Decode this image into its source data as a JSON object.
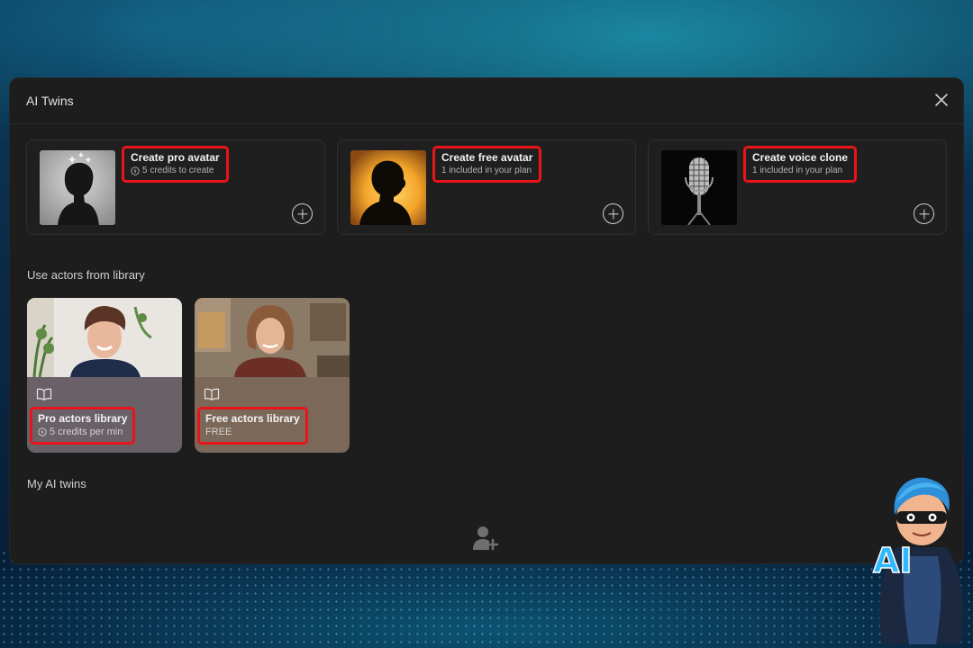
{
  "modal": {
    "title": "AI Twins",
    "close_icon": "close-icon"
  },
  "create_cards": [
    {
      "title": "Create pro avatar",
      "subtitle": "5 credits to create",
      "subtitle_icon": "credit-coin-icon",
      "action_icon": "plus-icon"
    },
    {
      "title": "Create free avatar",
      "subtitle": "1 included in your plan",
      "action_icon": "plus-icon"
    },
    {
      "title": "Create voice clone",
      "subtitle": "1 included in your plan",
      "action_icon": "plus-icon"
    }
  ],
  "library_section": {
    "label": "Use actors from library",
    "cards": [
      {
        "title": "Pro actors library",
        "subtitle": "5 credits per min",
        "icon": "book-open-icon",
        "subtitle_icon": "credit-coin-icon"
      },
      {
        "title": "Free actors library",
        "subtitle": "FREE",
        "icon": "book-open-icon"
      }
    ]
  },
  "my_twins_section": {
    "label": "My AI twins",
    "action_icon": "add-user-icon"
  },
  "overlay": {
    "mascot_text": "AI"
  },
  "colors": {
    "highlight": "#e8141a",
    "modal_bg": "#1d1d1d",
    "accent_orange": "#f3a52a"
  }
}
